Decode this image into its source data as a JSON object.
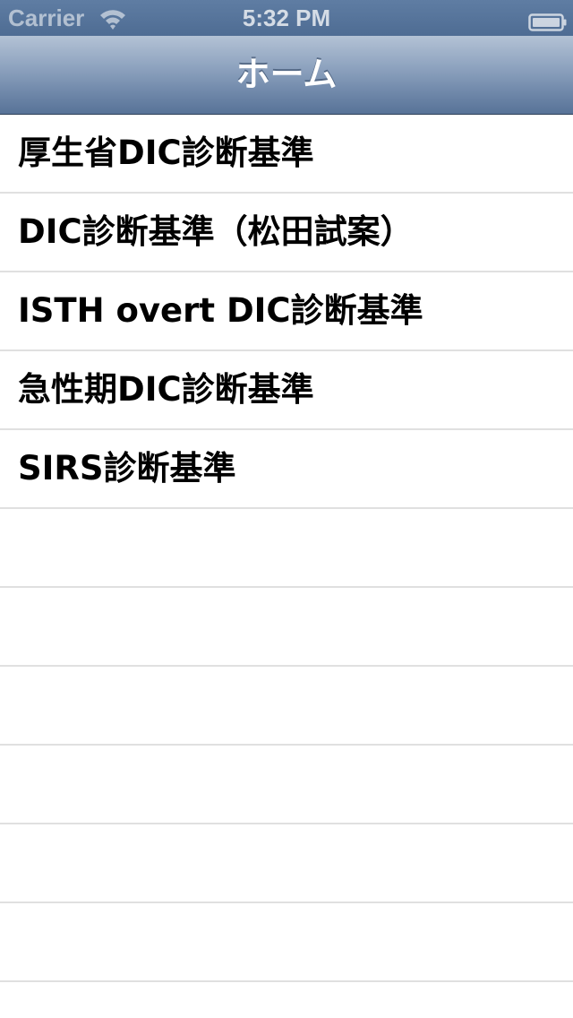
{
  "status_bar": {
    "carrier": "Carrier",
    "time": "5:32 PM",
    "icons": [
      "wifi-icon",
      "battery-icon"
    ]
  },
  "nav_bar": {
    "title": "ホーム"
  },
  "table": {
    "items": [
      {
        "label": "厚生省DIC診断基準"
      },
      {
        "label": "DIC診断基準（松田試案）"
      },
      {
        "label": "ISTH overt DIC診断基準"
      },
      {
        "label": "急性期DIC診断基準"
      },
      {
        "label": "SIRS診断基準"
      }
    ]
  },
  "colors": {
    "nav_bar_top": "#b3c2d5",
    "nav_bar_bottom": "#587398",
    "status_bar": "#5f7da3",
    "separator": "#e0e0e0"
  }
}
